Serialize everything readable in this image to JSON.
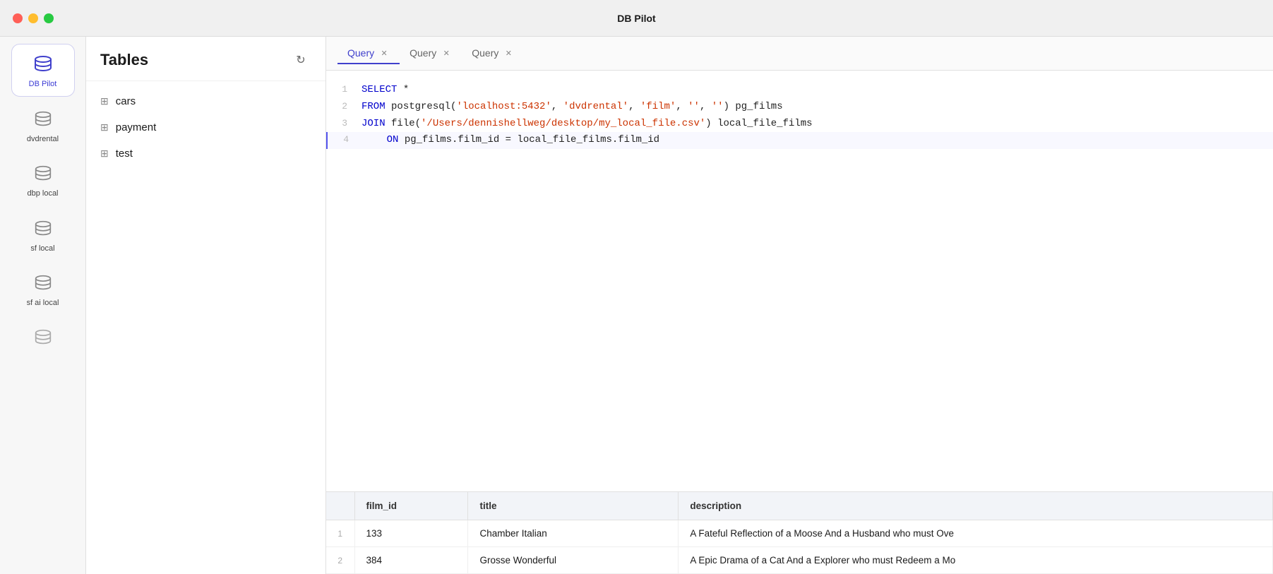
{
  "titlebar": {
    "title": "DB Pilot"
  },
  "sidebar": {
    "items": [
      {
        "id": "dbpilot",
        "label": "DB Pilot",
        "active": true
      },
      {
        "id": "dvdrental",
        "label": "dvdrental",
        "active": false
      },
      {
        "id": "dbp-local",
        "label": "dbp local",
        "active": false
      },
      {
        "id": "sf-local",
        "label": "sf local",
        "active": false
      },
      {
        "id": "sf-ai-local",
        "label": "sf ai local",
        "active": false
      },
      {
        "id": "more",
        "label": "",
        "active": false
      }
    ]
  },
  "tables_panel": {
    "title": "Tables",
    "items": [
      {
        "name": "cars"
      },
      {
        "name": "payment"
      },
      {
        "name": "test"
      }
    ]
  },
  "tabs": [
    {
      "label": "Query",
      "active": true
    },
    {
      "label": "Query",
      "active": false
    },
    {
      "label": "Query",
      "active": false
    }
  ],
  "code": {
    "lines": [
      {
        "num": "1",
        "content": "SELECT *",
        "parts": [
          {
            "text": "SELECT",
            "cls": "kw"
          },
          {
            "text": " *",
            "cls": "sym"
          }
        ]
      },
      {
        "num": "2",
        "content": "FROM postgresql('localhost:5432', 'dvdrental', 'film', '', '') pg_films",
        "parts": [
          {
            "text": "FROM",
            "cls": "kw"
          },
          {
            "text": " postgresql(",
            "cls": "sym"
          },
          {
            "text": "'localhost:5432'",
            "cls": "str"
          },
          {
            "text": ", ",
            "cls": "sym"
          },
          {
            "text": "'dvdrental'",
            "cls": "str"
          },
          {
            "text": ", ",
            "cls": "sym"
          },
          {
            "text": "'film'",
            "cls": "str"
          },
          {
            "text": ", ",
            "cls": "sym"
          },
          {
            "text": "''",
            "cls": "str"
          },
          {
            "text": ", ",
            "cls": "sym"
          },
          {
            "text": "''",
            "cls": "str"
          },
          {
            "text": ") pg_films",
            "cls": "sym"
          }
        ]
      },
      {
        "num": "3",
        "content": "JOIN file('/Users/dennishellweg/desktop/my_local_file.csv') local_file_films",
        "parts": [
          {
            "text": "JOIN",
            "cls": "kw"
          },
          {
            "text": " file(",
            "cls": "sym"
          },
          {
            "text": "'/Users/dennishellweg/desktop/my_local_file.csv'",
            "cls": "str"
          },
          {
            "text": ") local_file_films",
            "cls": "sym"
          }
        ]
      },
      {
        "num": "4",
        "content": "    ON pg_films.film_id = local_file_films.film_id",
        "parts": [
          {
            "text": "    ON",
            "cls": "kw"
          },
          {
            "text": " pg_films.film_id = local_file_films.film_id",
            "cls": "sym"
          }
        ],
        "cursor": true
      }
    ]
  },
  "results": {
    "columns": [
      "film_id",
      "title",
      "description"
    ],
    "rows": [
      {
        "num": "1",
        "film_id": "133",
        "title": "Chamber Italian",
        "description": "A Fateful Reflection of a Moose And a Husband who must Ove"
      },
      {
        "num": "2",
        "film_id": "384",
        "title": "Grosse Wonderful",
        "description": "A Epic Drama of a Cat And a Explorer who must Redeem a Mo"
      }
    ]
  }
}
